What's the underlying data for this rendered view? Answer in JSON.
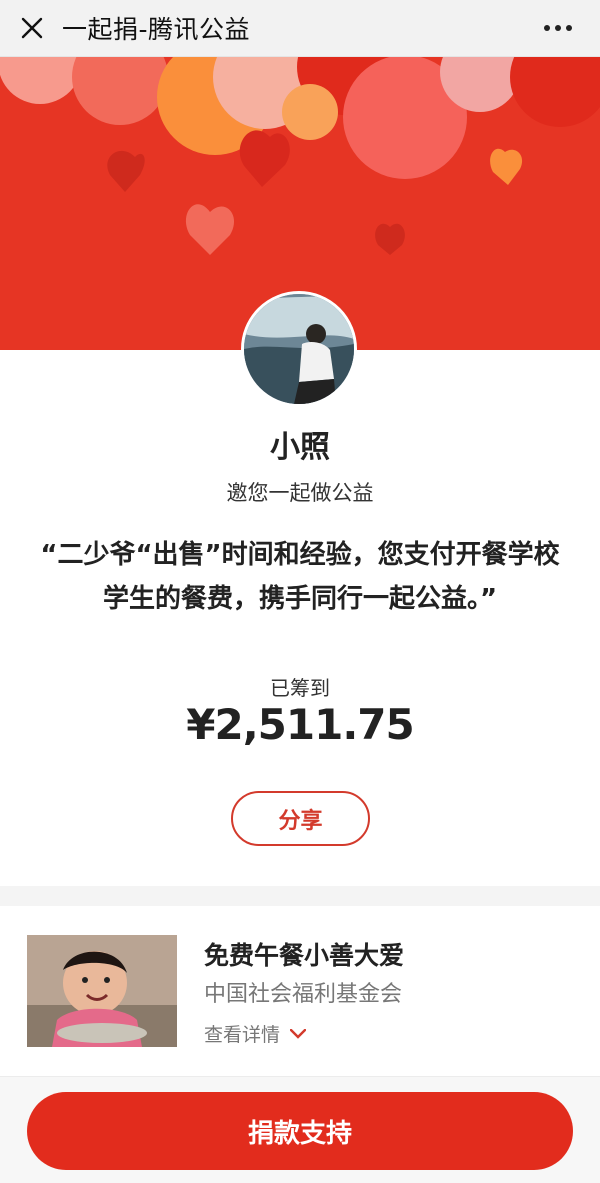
{
  "topbar": {
    "title": "一起捐-腾讯公益",
    "close_icon": "close-icon",
    "more_icon": "more-icon"
  },
  "profile": {
    "name": "小照",
    "invite": "邀您一起做公益"
  },
  "quote": "“二少爷“出售”时间和经验，您支付开餐学校学生的餐费，携手同行一起公益。”",
  "raised": {
    "label": "已筹到",
    "amount": "¥2,511.75"
  },
  "share": {
    "label": "分享"
  },
  "project": {
    "title": "免费午餐小善大爱",
    "org": "中国社会福利基金会",
    "details": "查看详情"
  },
  "donate": {
    "label": "捐款支持"
  },
  "colors": {
    "brand_red": "#e63524",
    "button_red": "#e22c1d",
    "accent_red": "#d33a2c"
  }
}
